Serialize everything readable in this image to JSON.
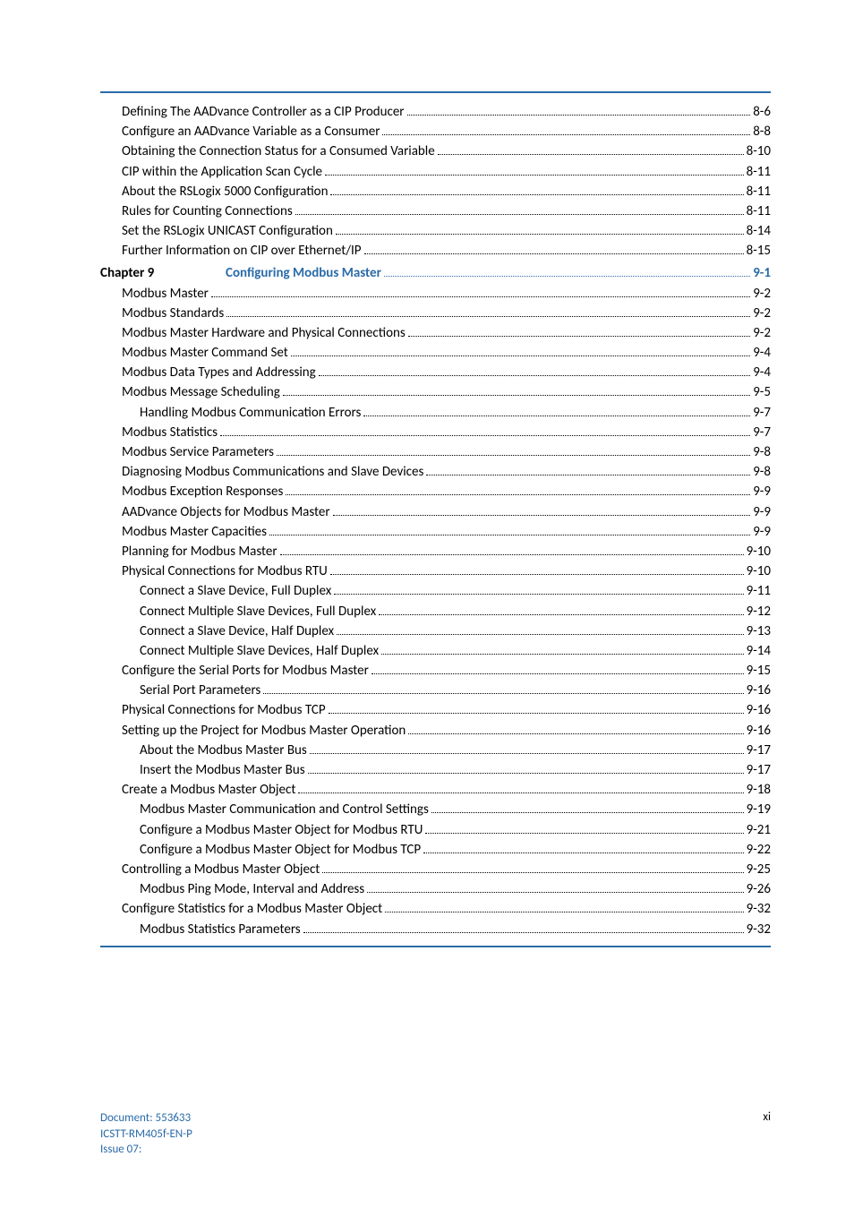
{
  "colors": {
    "accent": "#2a6ba8"
  },
  "toc": {
    "pre_chapter": [
      {
        "level": 1,
        "label": "Defining The AADvance Controller as a CIP Producer",
        "page": "8-6"
      },
      {
        "level": 1,
        "label": "Configure an AADvance Variable as a Consumer",
        "page": "8-8"
      },
      {
        "level": 1,
        "label": "Obtaining the Connection Status for a Consumed Variable",
        "page": "8-10"
      },
      {
        "level": 1,
        "label": "CIP within the Application Scan Cycle",
        "page": "8-11"
      },
      {
        "level": 1,
        "label": "About the RSLogix 5000 Configuration",
        "page": "8-11"
      },
      {
        "level": 1,
        "label": "Rules for Counting Connections",
        "page": "8-11"
      },
      {
        "level": 1,
        "label": "Set the RSLogix UNICAST Configuration",
        "page": "8-14"
      },
      {
        "level": 1,
        "label": "Further Information on CIP over Ethernet/IP",
        "page": "8-15"
      }
    ],
    "chapter": {
      "label": "Chapter 9",
      "title": "Configuring Modbus Master",
      "page": "9-1"
    },
    "post_chapter": [
      {
        "level": 1,
        "label": "Modbus Master",
        "page": "9-2"
      },
      {
        "level": 1,
        "label": "Modbus Standards",
        "page": "9-2"
      },
      {
        "level": 1,
        "label": "Modbus Master Hardware and Physical Connections",
        "page": "9-2"
      },
      {
        "level": 1,
        "label": "Modbus Master Command Set",
        "page": "9-4"
      },
      {
        "level": 1,
        "label": "Modbus Data Types and Addressing",
        "page": "9-4"
      },
      {
        "level": 1,
        "label": "Modbus Message Scheduling",
        "page": "9-5"
      },
      {
        "level": 2,
        "label": "Handling Modbus Communication Errors",
        "page": "9-7"
      },
      {
        "level": 1,
        "label": "Modbus Statistics",
        "page": "9-7"
      },
      {
        "level": 1,
        "label": "Modbus Service Parameters",
        "page": "9-8"
      },
      {
        "level": 1,
        "label": "Diagnosing Modbus Communications and Slave Devices",
        "page": "9-8"
      },
      {
        "level": 1,
        "label": "Modbus Exception Responses",
        "page": "9-9"
      },
      {
        "level": 1,
        "label": "AADvance Objects for Modbus Master",
        "page": "9-9"
      },
      {
        "level": 1,
        "label": "Modbus Master Capacities",
        "page": "9-9"
      },
      {
        "level": 1,
        "label": "Planning for Modbus Master",
        "page": "9-10"
      },
      {
        "level": 1,
        "label": "Physical Connections for Modbus RTU",
        "page": "9-10"
      },
      {
        "level": 2,
        "label": "Connect a Slave Device, Full Duplex",
        "page": "9-11"
      },
      {
        "level": 2,
        "label": "Connect Multiple Slave Devices, Full Duplex",
        "page": "9-12"
      },
      {
        "level": 2,
        "label": "Connect a Slave Device, Half Duplex",
        "page": "9-13"
      },
      {
        "level": 2,
        "label": "Connect Multiple Slave Devices, Half Duplex",
        "page": "9-14"
      },
      {
        "level": 1,
        "label": "Configure the Serial Ports for Modbus Master",
        "page": "9-15"
      },
      {
        "level": 2,
        "label": "Serial Port Parameters",
        "page": "9-16"
      },
      {
        "level": 1,
        "label": "Physical Connections for Modbus TCP",
        "page": "9-16"
      },
      {
        "level": 1,
        "label": "Setting up the Project for Modbus Master Operation",
        "page": "9-16"
      },
      {
        "level": 2,
        "label": "About the Modbus Master Bus",
        "page": "9-17"
      },
      {
        "level": 3,
        "label": "Insert the Modbus Master Bus",
        "page": "9-17"
      },
      {
        "level": 1,
        "label": "Create a Modbus Master Object",
        "page": "9-18"
      },
      {
        "level": 2,
        "label": "Modbus Master Communication and Control Settings",
        "page": "9-19"
      },
      {
        "level": 3,
        "label": "Configure a Modbus Master Object for Modbus RTU",
        "page": "9-21"
      },
      {
        "level": 3,
        "label": "Configure a Modbus Master Object for Modbus TCP",
        "page": "9-22"
      },
      {
        "level": 1,
        "label": "Controlling a Modbus Master Object",
        "page": "9-25"
      },
      {
        "level": 2,
        "label": "Modbus Ping Mode, Interval and Address",
        "page": "9-26"
      },
      {
        "level": 1,
        "label": "Configure Statistics for a Modbus Master Object",
        "page": "9-32"
      },
      {
        "level": 2,
        "label": "Modbus Statistics Parameters",
        "page": "9-32"
      }
    ]
  },
  "footer": {
    "doc_line1": "Document: 553633",
    "doc_line2": "ICSTT-RM405f-EN-P",
    "issue": "Issue 07:",
    "page_number": "xi"
  }
}
